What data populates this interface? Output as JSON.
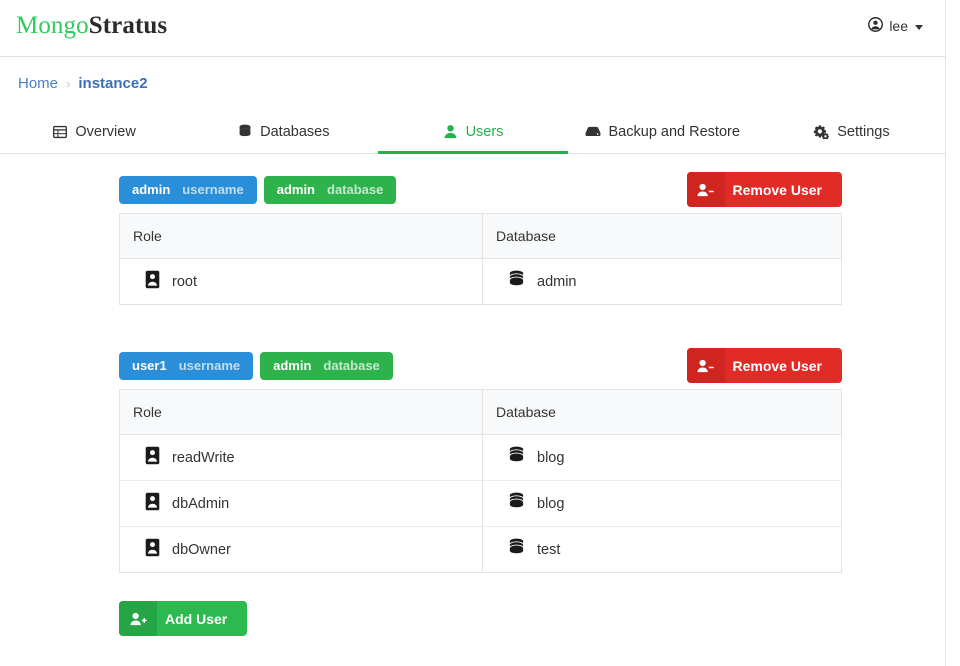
{
  "navbar": {
    "brand_primary": "Mongo",
    "brand_secondary": "Stratus",
    "user_icon": "user-circle-icon",
    "user_name": "lee",
    "caret_icon": "caret-down-icon"
  },
  "breadcrumb": {
    "home_label": "Home",
    "separator": "›",
    "current_label": "instance2"
  },
  "tabs": [
    {
      "label": "Overview",
      "icon": "table-icon",
      "active": false
    },
    {
      "label": "Databases",
      "icon": "database-icon",
      "active": false
    },
    {
      "label": "Users",
      "icon": "user-icon",
      "active": true
    },
    {
      "label": "Backup and Restore",
      "icon": "hard-drive-icon",
      "active": false
    },
    {
      "label": "Settings",
      "icon": "gears-icon",
      "active": false
    }
  ],
  "table_headers": {
    "role": "Role",
    "database": "Database"
  },
  "buttons": {
    "remove_user": "Remove User",
    "remove_user_icon": "user-minus-icon",
    "add_user": "Add User",
    "add_user_icon": "user-plus-icon"
  },
  "colors": {
    "brand_green": "#2ecc58",
    "accent_green": "#22b14c",
    "badge_blue": "#2a8fd8",
    "badge_green": "#2eb34c",
    "danger_red": "#e02b27",
    "success_green": "#2cb94f",
    "breadcrumb_blue": "#4a7fc1"
  },
  "users": [
    {
      "username_value": "admin",
      "username_label": "username",
      "database_value": "admin",
      "database_label": "database",
      "roles": [
        {
          "role": "root",
          "role_icon": "id-badge-icon",
          "database": "admin",
          "db_icon": "database-icon"
        }
      ]
    },
    {
      "username_value": "user1",
      "username_label": "username",
      "database_value": "admin",
      "database_label": "database",
      "roles": [
        {
          "role": "readWrite",
          "role_icon": "id-badge-icon",
          "database": "blog",
          "db_icon": "database-icon"
        },
        {
          "role": "dbAdmin",
          "role_icon": "id-badge-icon",
          "database": "blog",
          "db_icon": "database-icon"
        },
        {
          "role": "dbOwner",
          "role_icon": "id-badge-icon",
          "database": "test",
          "db_icon": "database-icon"
        }
      ]
    }
  ]
}
